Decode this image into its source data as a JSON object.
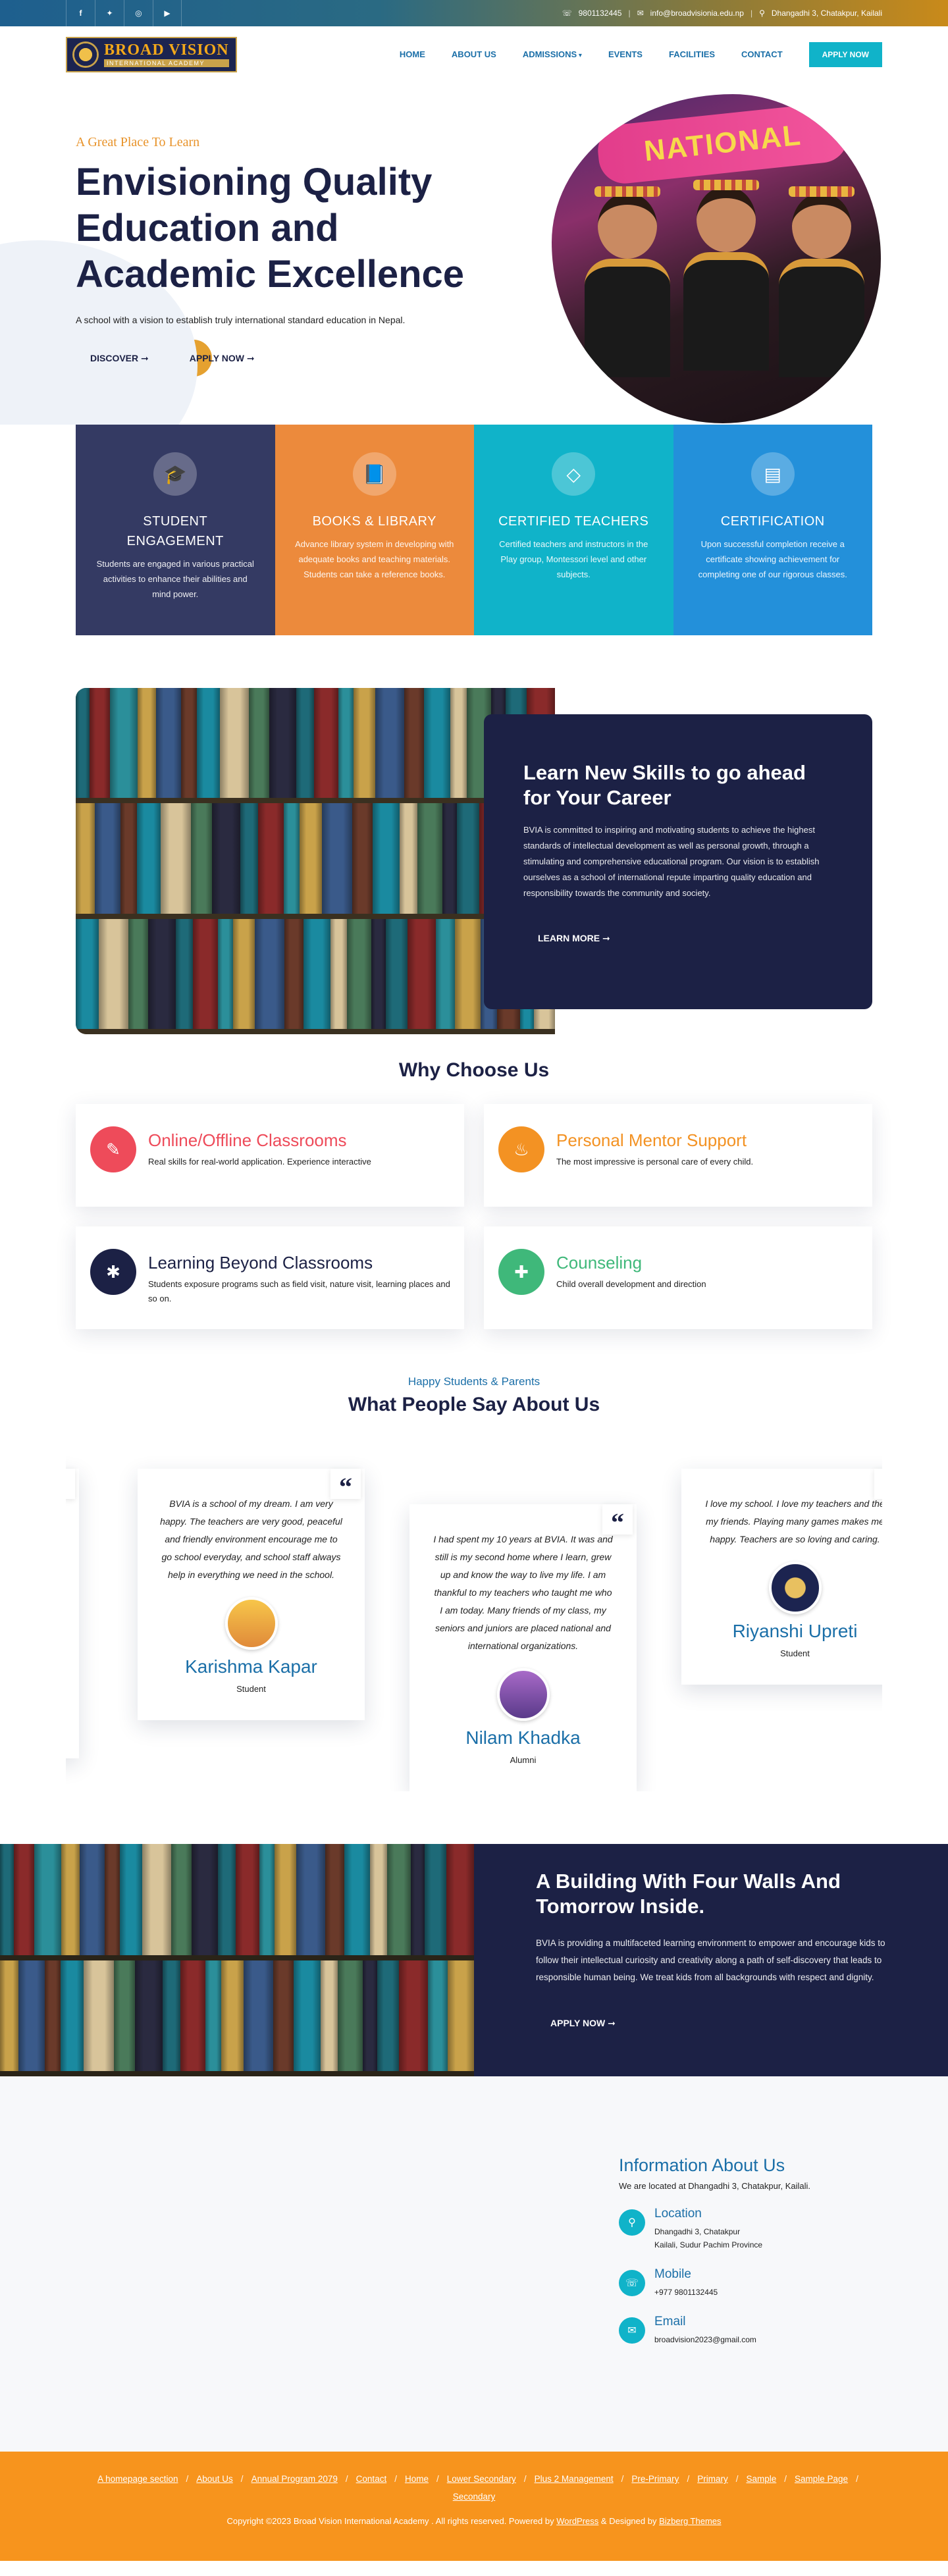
{
  "topbar": {
    "socials": [
      {
        "icon": "facebook-icon",
        "glyph": "f"
      },
      {
        "icon": "twitter-icon",
        "glyph": "✦"
      },
      {
        "icon": "instagram-icon",
        "glyph": "◎"
      },
      {
        "icon": "youtube-icon",
        "glyph": "▶"
      }
    ],
    "phone": "9801132445",
    "email": "info@broadvisionia.edu.np",
    "address": "Dhangadhi 3, Chatakpur, Kailali"
  },
  "header": {
    "logo_title": "BROAD VISION",
    "logo_subtitle": "INTERNATIONAL ACADEMY",
    "nav": [
      "HOME",
      "ABOUT US",
      "ADMISSIONS",
      "EVENTS",
      "FACILITIES",
      "CONTACT"
    ],
    "apply_label": "APPLY NOW"
  },
  "hero": {
    "tagline": "A Great Place To Learn",
    "title": "Envisioning Quality Education and Academic Excellence",
    "subtitle": "A school with a vision to establish truly international standard education in Nepal.",
    "btn_discover": "DISCOVER ➞",
    "btn_apply": "APPLY NOW ➞",
    "banner_text": "NATIONAL"
  },
  "features": [
    {
      "icon": "graduation-cap-icon",
      "glyph": "🎓",
      "title": "STUDENT ENGAGEMENT",
      "text": "Students are engaged in various practical activities to enhance their abilities and mind power.",
      "color": "#343a63"
    },
    {
      "icon": "book-icon",
      "glyph": "📘",
      "title": "BOOKS & LIBRARY",
      "text": "Advance library system in developing with adequate books and teaching materials. Students can take a reference books.",
      "color": "#ec8a3c"
    },
    {
      "icon": "diamond-icon",
      "glyph": "◇",
      "title": "CERTIFIED TEACHERS",
      "text": "Certified teachers and instructors in the Play group, Montessori level and other subjects.",
      "color": "#10b3c9"
    },
    {
      "icon": "certificate-icon",
      "glyph": "▤",
      "title": "CERTIFICATION",
      "text": "Upon successful completion receive a certificate showing achievement for completing one of our rigorous classes.",
      "color": "#2390da"
    }
  ],
  "about": {
    "title": "Learn New Skills to go ahead for Your Career",
    "text": "BVIA is committed to inspiring and motivating students to achieve the highest standards of intellectual development as well as personal growth, through a stimulating and comprehensive educational program. Our vision is to establish ourselves as a school of international repute imparting quality education and responsibility towards the community and society.",
    "btn": "LEARN MORE ➞"
  },
  "why": {
    "title": "Why Choose Us",
    "cards": [
      {
        "icon": "pencil-icon",
        "glyph": "✎",
        "title": "Online/Offline Classrooms",
        "text": "Real skills for real-world application. Experience interactive",
        "color": "#ee4b5a"
      },
      {
        "icon": "flame-icon",
        "glyph": "♨",
        "title": "Personal Mentor Support",
        "text": "The most impressive is personal care of every child.",
        "color": "#f39223"
      },
      {
        "icon": "puzzle-icon",
        "glyph": "✱",
        "title": "Learning Beyond Classrooms",
        "text": "Students exposure programs such as field visit, nature visit, learning places and so on.",
        "color": "#1c2145"
      },
      {
        "icon": "badge-icon",
        "glyph": "✚",
        "title": "Counseling",
        "text": "Child overall development and direction",
        "color": "#3fb87a"
      }
    ]
  },
  "testimonials": {
    "tag": "Happy Students & Parents",
    "title": "What People Say About Us",
    "items": [
      {
        "quote": "BVIA is a school of my dream. I am very happy. The teachers are very good, peaceful and friendly environment encourage me to go school everyday, and school staff always help in everything we need in the school.",
        "name": "Karishma Kapar",
        "role": "Student"
      },
      {
        "quote": "I had spent my 10 years at BVIA. It was and still is my second home where I learn, grew up and know the way to live my life. I am thankful to my teachers who taught me who I am today. Many friends of my class, my seniors and juniors are placed national and international organizations.",
        "name": "Nilam Khadka",
        "role": "Alumni"
      },
      {
        "quote": "I love my school. I love my teachers and the my friends. Playing many games makes me happy. Teachers are so loving and caring.",
        "name": "Riyanshi Upreti",
        "role": "Student"
      }
    ]
  },
  "building": {
    "title": "A Building With Four Walls And Tomorrow Inside.",
    "text": "BVIA is providing a multifaceted learning environment to empower and encourage kids to follow their intellectual curiosity and creativity along a path of self-discovery that leads to responsible human being. We treat kids from all backgrounds with respect and dignity.",
    "btn": "APPLY NOW ➞"
  },
  "info": {
    "title": "Information About Us",
    "located": "We are located at Dhangadhi 3, Chatakpur, Kailali.",
    "location_label": "Location",
    "location_line1": "Dhangadhi 3, Chatakpur",
    "location_line2": "Kailali, Sudur Pachim Province",
    "mobile_label": "Mobile",
    "mobile": "+977 9801132445",
    "email_label": "Email",
    "email": "broadvision2023@gmail.com"
  },
  "footer": {
    "links": [
      "A homepage section",
      "About Us",
      "Annual Program 2079",
      "Contact",
      "Home",
      "Lower Secondary",
      "Plus 2 Management",
      "Pre-Primary",
      "Primary",
      "Sample",
      "Sample Page",
      "Secondary"
    ],
    "copyright_prefix": "Copyright ©2023 Broad Vision International Academy . All rights reserved. Powered by",
    "wordpress": "WordPress",
    "designed_by": "& Designed by",
    "themes": "Bizberg Themes"
  }
}
